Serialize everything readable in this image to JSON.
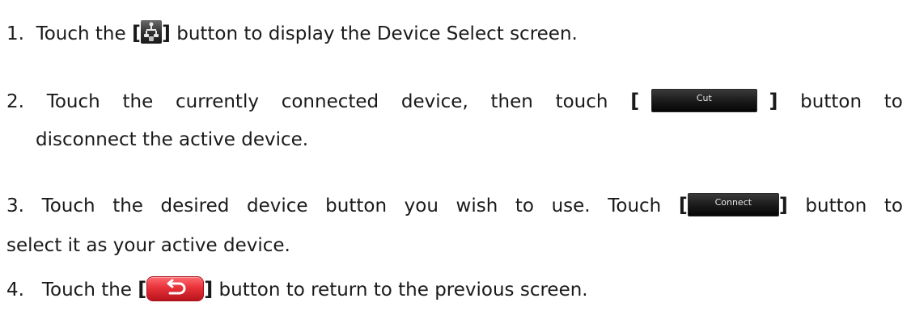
{
  "steps": [
    {
      "number": "1.",
      "before": "Touch the",
      "bracket_open": "[",
      "icon": "device-select-icon",
      "bracket_close": "]",
      "after": "button to display the Device Select screen."
    },
    {
      "number": "2.",
      "words": [
        "Touch",
        "the",
        "currently",
        "connected",
        "device,",
        "then",
        "touch"
      ],
      "bracket_open": "[",
      "button_label": "Cut",
      "bracket_close": "]",
      "after_words": [
        "button",
        "to"
      ],
      "continuation": "disconnect the active device."
    },
    {
      "number": "3.",
      "words": [
        "Touch",
        "the",
        "desired",
        "device",
        "button",
        "you",
        "wish",
        "to",
        "use.",
        "Touch"
      ],
      "bracket_open": "[",
      "button_label": "Connect",
      "bracket_close": "]",
      "after_words": [
        "button",
        "to"
      ],
      "continuation": "select it as your active device."
    },
    {
      "number": "4.",
      "before": "Touch the",
      "bracket_open": "[",
      "icon": "back-arrow-icon",
      "bracket_close": "]",
      "after": "button to return to the previous screen."
    }
  ],
  "colors": {
    "text": "#1a1a1a",
    "back_button": "#e8323a",
    "dark_button": "#1e1e1e"
  }
}
